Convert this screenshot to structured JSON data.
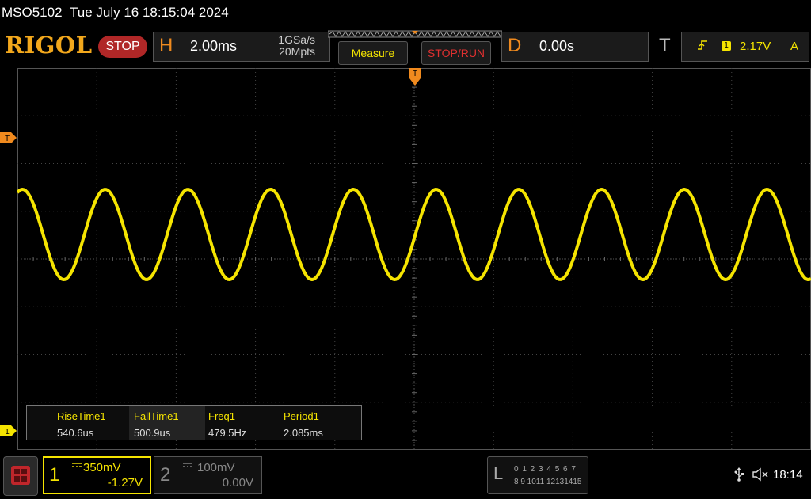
{
  "title_bar": {
    "model": "MSO5102",
    "datetime": "Tue July 16 18:15:04 2024"
  },
  "header": {
    "logo": "RIGOL",
    "run_status": "STOP",
    "horizontal": {
      "letter": "H",
      "timebase": "2.00ms",
      "sample_rate": "1GSa/s",
      "memory_depth": "20Mpts"
    },
    "measure_label": "Measure",
    "stop_run_label": "STOP/RUN",
    "delay": {
      "letter": "D",
      "value": "0.00s"
    },
    "trigger": {
      "letter": "T",
      "edge_icon": "rising-edge-icon",
      "source": "1",
      "level": "2.17V",
      "mode": "A"
    }
  },
  "markers": {
    "trigger_position": "T",
    "trigger_level": "T",
    "channel1": "1"
  },
  "measurements": [
    {
      "label": "RiseTime1",
      "value": "540.6us"
    },
    {
      "label": "FallTime1",
      "value": "500.9us"
    },
    {
      "label": "Freq1",
      "value": "479.5Hz"
    },
    {
      "label": "Period1",
      "value": "2.085ms"
    }
  ],
  "channels": [
    {
      "number": "1",
      "coupling_icon": "dc-coupling-icon",
      "scale": "350mV",
      "offset": "-1.27V",
      "active": true,
      "color": "#f5e400"
    },
    {
      "number": "2",
      "coupling_icon": "dc-coupling-icon",
      "scale": "100mV",
      "offset": "0.00V",
      "active": false,
      "color": "#888888"
    }
  ],
  "logic_analyzer": {
    "letter": "L",
    "row1": "0 1 2 3  4 5 6 7",
    "row2": "8 9 1011 12131415"
  },
  "status": {
    "usb_icon": "usb-icon",
    "speaker_icon": "speaker-muted-icon",
    "time": "18:14"
  },
  "colors": {
    "trace": "#f5e400",
    "accent": "#f08a1e",
    "stop": "#b02727"
  },
  "waveform": {
    "channel": "1",
    "frequency_hz": 479.5,
    "period_ms": 2.085,
    "timebase_ms_per_div": 2.0,
    "divisions_horizontal": 10,
    "divisions_vertical": 8
  }
}
